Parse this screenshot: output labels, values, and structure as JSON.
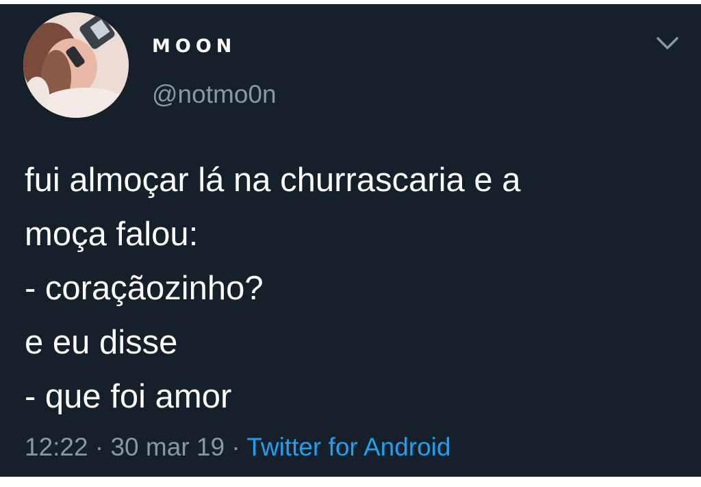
{
  "tweet": {
    "display_name": "MOON",
    "handle": "@notmo0n",
    "text_lines": [
      "fui almoçar lá na churrascaria e a",
      "moça falou:",
      "- coraçãozinho?",
      "e eu disse",
      "- que foi amor"
    ],
    "time": "12:22",
    "separator": " · ",
    "date": "30 mar 19",
    "source": "Twitter for Android"
  },
  "icons": {
    "avatar": "profile-photo",
    "menu": "chevron-down-icon"
  },
  "colors": {
    "background": "#15202b",
    "text": "#ffffff",
    "secondary_text": "#8899a6",
    "link": "#1da1f2"
  }
}
